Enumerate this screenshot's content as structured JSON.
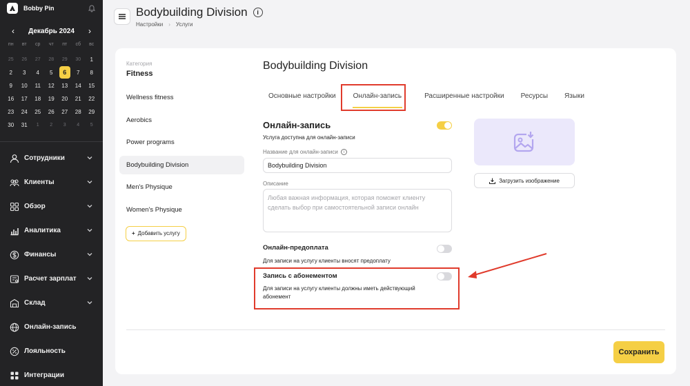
{
  "sidebar": {
    "brand": "Bobby Pin",
    "calendar": {
      "month": "Декабрь 2024",
      "prev": "‹",
      "next": "›",
      "weekdays": [
        "пн",
        "вт",
        "ср",
        "чт",
        "пт",
        "сб",
        "вс"
      ],
      "days": [
        [
          "25",
          "26",
          "27",
          "28",
          "29",
          "30",
          "1"
        ],
        [
          "2",
          "3",
          "4",
          "5",
          "6",
          "7",
          "8"
        ],
        [
          "9",
          "10",
          "11",
          "12",
          "13",
          "14",
          "15"
        ],
        [
          "16",
          "17",
          "18",
          "19",
          "20",
          "21",
          "22"
        ],
        [
          "23",
          "24",
          "25",
          "26",
          "27",
          "28",
          "29"
        ],
        [
          "30",
          "31",
          "1",
          "2",
          "3",
          "4",
          "5"
        ]
      ],
      "today": "6"
    },
    "nav": [
      {
        "label": "Сотрудники",
        "icon": "user-icon"
      },
      {
        "label": "Клиенты",
        "icon": "users-icon"
      },
      {
        "label": "Обзор",
        "icon": "grid-icon"
      },
      {
        "label": "Аналитика",
        "icon": "chart-icon"
      },
      {
        "label": "Финансы",
        "icon": "dollar-icon"
      },
      {
        "label": "Расчет зарплат",
        "icon": "payroll-icon"
      },
      {
        "label": "Склад",
        "icon": "warehouse-icon"
      },
      {
        "label": "Онлайн-запись",
        "icon": "globe-icon"
      },
      {
        "label": "Лояльность",
        "icon": "percent-icon"
      },
      {
        "label": "Интеграции",
        "icon": "integrations-icon"
      }
    ]
  },
  "header": {
    "title": "Bodybuilding Division",
    "info": "i",
    "breadcrumb": [
      "Настройки",
      "Услуги"
    ],
    "breadcrumb_sep": "›"
  },
  "left_panel": {
    "category_label": "Категория",
    "category_value": "Fitness",
    "services": [
      "Wellness fitness",
      "Aerobics",
      "Power programs",
      "Bodybuilding Division",
      "Men's Physique",
      "Women's Physique"
    ],
    "active_service": "Bodybuilding Division",
    "add_button": "Добавить услугу"
  },
  "main": {
    "title": "Bodybuilding Division",
    "tabs": [
      "Основные настройки",
      "Онлайн-запись",
      "Расширенные настройки",
      "Ресурсы",
      "Языки"
    ],
    "active_tab": "Онлайн-запись",
    "online": {
      "title": "Онлайн-запись",
      "enabled": true,
      "subtitle": "Услуга доступна для онлайн-записи",
      "name_label": "Название для онлайн-записи",
      "name_value": "Bodybuilding Division",
      "desc_label": "Описание",
      "desc_placeholder": "Любая важная информация, которая поможет клиенту сделать выбор при самостоятельной записи онлайн"
    },
    "prepay": {
      "title": "Онлайн-предоплата",
      "enabled": false,
      "desc": "Для записи на услугу клиенты вносят предоплату"
    },
    "subscription": {
      "title": "Запись с абонементом",
      "enabled": false,
      "desc_line1": "Для записи на услугу клиенты должны иметь действующий",
      "desc_line2": "абонемент"
    },
    "upload_button": "Загрузить изображение",
    "save_button": "Сохранить"
  },
  "colors": {
    "accent": "#f5cf45",
    "annotation": "#e03a2b",
    "sidebar_bg": "#232325",
    "image_placeholder": "#ebe8fb"
  }
}
